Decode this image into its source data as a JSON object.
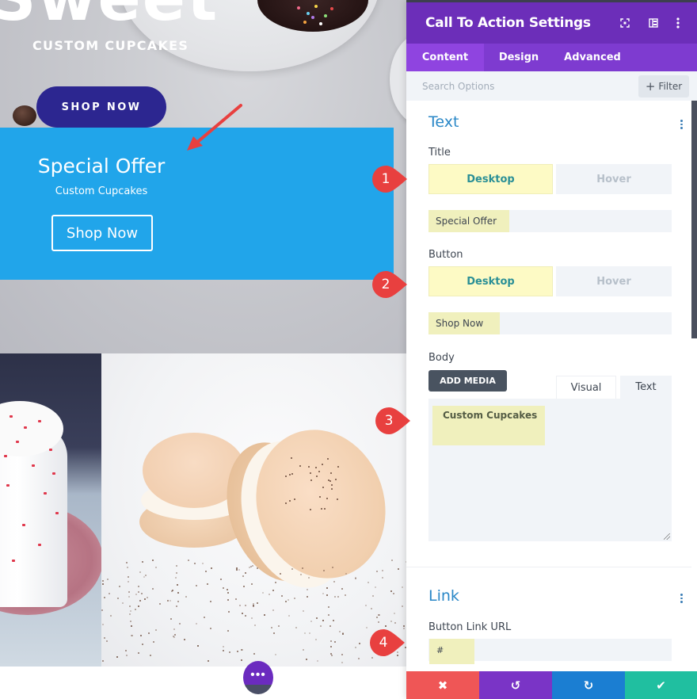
{
  "canvas": {
    "hero": {
      "big_text": "Sweet",
      "subtitle": "CUSTOM CUPCAKES",
      "button_label": "SHOP NOW"
    },
    "cta": {
      "title": "Special Offer",
      "body": "Custom Cupcakes",
      "button_label": "Shop Now",
      "background_color": "#21a5ea"
    },
    "fab_label": "•••"
  },
  "markers": [
    {
      "number": "1",
      "points_to": "title-desktop-toggle"
    },
    {
      "number": "2",
      "points_to": "button-desktop-toggle"
    },
    {
      "number": "3",
      "points_to": "body-editor"
    },
    {
      "number": "4",
      "points_to": "button-link-url-field"
    }
  ],
  "panel": {
    "title": "Call To Action Settings",
    "header_icons": [
      "fullscreen-icon",
      "split-view-icon",
      "more-options-icon"
    ],
    "tabs": [
      {
        "label": "Content",
        "active": true
      },
      {
        "label": "Design",
        "active": false
      },
      {
        "label": "Advanced",
        "active": false
      }
    ],
    "search": {
      "placeholder": "Search Options",
      "value": ""
    },
    "filter_label": "Filter",
    "sections": {
      "text": {
        "title": "Text",
        "title_field": {
          "label": "Title",
          "toggle": {
            "desktop": "Desktop",
            "hover": "Hover",
            "selected": "Desktop"
          },
          "value": "Special Offer"
        },
        "button_field": {
          "label": "Button",
          "toggle": {
            "desktop": "Desktop",
            "hover": "Hover",
            "selected": "Desktop"
          },
          "value": "Shop Now"
        },
        "body_field": {
          "label": "Body",
          "add_media": "ADD MEDIA",
          "editor_tabs": {
            "visual": "Visual",
            "text": "Text",
            "selected": "Text"
          },
          "value": "Custom Cupcakes"
        }
      },
      "link": {
        "title": "Link",
        "url_field": {
          "label": "Button Link URL",
          "value": "#"
        }
      }
    },
    "footer": {
      "cancel_icon": "✖",
      "undo_icon": "↺",
      "redo_icon": "↻",
      "save_icon": "✔",
      "colors": {
        "cancel": "#ef5656",
        "undo": "#7a34c6",
        "redo": "#1b7ed2",
        "save": "#20bfa0"
      }
    },
    "accent_color": "#6c2eb9"
  }
}
